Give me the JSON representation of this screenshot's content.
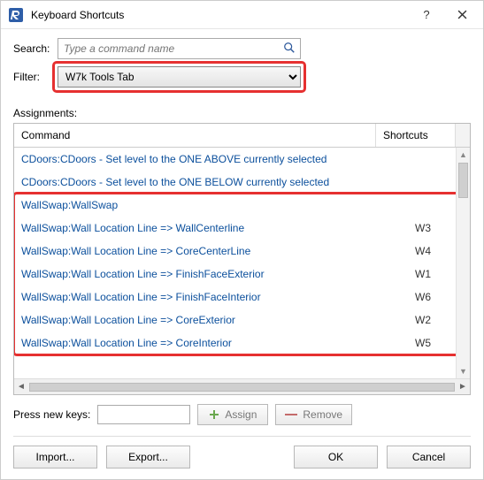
{
  "window": {
    "title": "Keyboard Shortcuts",
    "help_aria": "Help",
    "close_aria": "Close"
  },
  "search": {
    "label": "Search:",
    "placeholder": "Type a command name",
    "value": ""
  },
  "filter": {
    "label": "Filter:",
    "selected": "W7k Tools Tab"
  },
  "assignments_label": "Assignments:",
  "columns": {
    "command": "Command",
    "shortcuts": "Shortcuts"
  },
  "rows": [
    {
      "command": "CDoors:CDoors - Set level to the ONE ABOVE currently selected",
      "shortcut": ""
    },
    {
      "command": "CDoors:CDoors - Set level to the ONE BELOW currently selected",
      "shortcut": ""
    },
    {
      "command": "WallSwap:WallSwap",
      "shortcut": ""
    },
    {
      "command": "WallSwap:Wall Location Line => WallCenterline",
      "shortcut": "W3"
    },
    {
      "command": "WallSwap:Wall Location Line => CoreCenterLine",
      "shortcut": "W4"
    },
    {
      "command": "WallSwap:Wall Location Line => FinishFaceExterior",
      "shortcut": "W1"
    },
    {
      "command": "WallSwap:Wall Location Line => FinishFaceInterior",
      "shortcut": "W6"
    },
    {
      "command": "WallSwap:Wall Location Line => CoreExterior",
      "shortcut": "W2"
    },
    {
      "command": "WallSwap:Wall Location Line => CoreInterior",
      "shortcut": "W5"
    }
  ],
  "press_new_keys": {
    "label": "Press new keys:",
    "value": ""
  },
  "buttons": {
    "assign": "Assign",
    "remove": "Remove",
    "import": "Import...",
    "export": "Export...",
    "ok": "OK",
    "cancel": "Cancel"
  }
}
